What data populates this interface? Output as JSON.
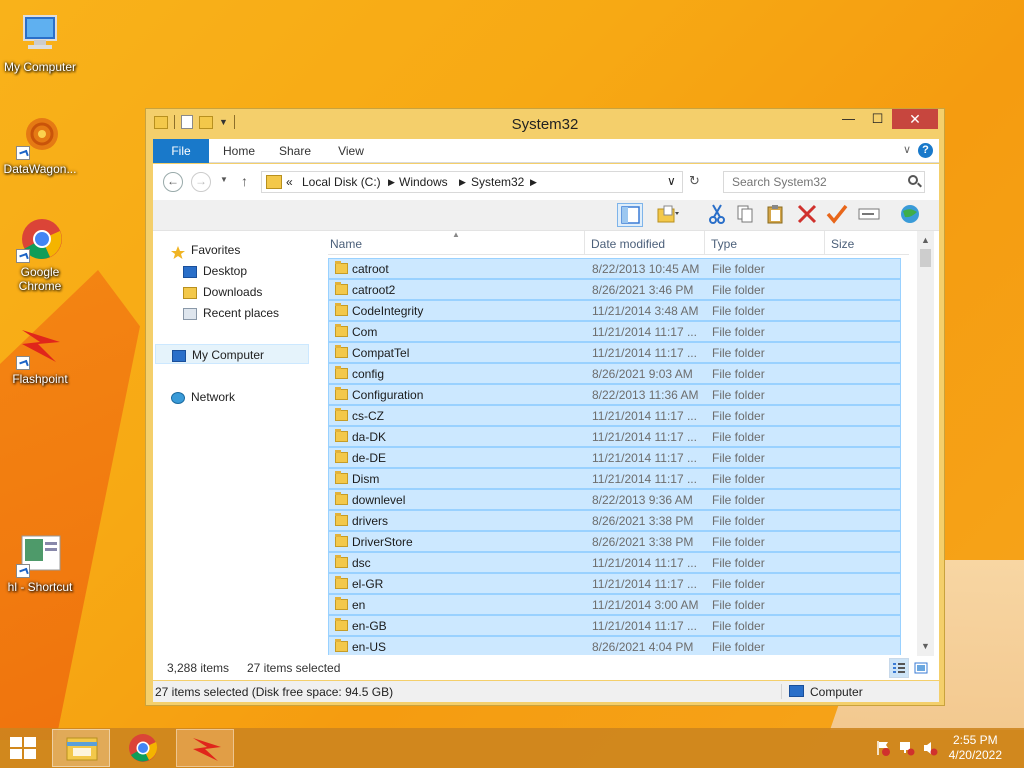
{
  "desktop": {
    "icons": [
      {
        "label": "My Computer"
      },
      {
        "label": "DataWagon..."
      },
      {
        "label": "Google Chrome"
      },
      {
        "label": "Flashpoint"
      },
      {
        "label": "hl - Shortcut"
      }
    ]
  },
  "window": {
    "title": "System32",
    "ribbon_tabs": {
      "file": "File",
      "home": "Home",
      "share": "Share",
      "view": "View"
    },
    "help_label": "?",
    "address": {
      "chevron": "«",
      "crumbs": [
        "Local Disk (C:)",
        "Windows",
        "System32"
      ]
    },
    "search": {
      "placeholder": "Search System32"
    },
    "nav_pane": {
      "favorites": "Favorites",
      "desktop": "Desktop",
      "downloads": "Downloads",
      "recent": "Recent places",
      "computer": "My Computer",
      "network": "Network"
    },
    "columns": {
      "name": "Name",
      "date": "Date modified",
      "type": "Type",
      "size": "Size"
    },
    "rows": [
      {
        "name": "catroot",
        "date": "8/22/2013 10:45 AM",
        "type": "File folder"
      },
      {
        "name": "catroot2",
        "date": "8/26/2021 3:46 PM",
        "type": "File folder"
      },
      {
        "name": "CodeIntegrity",
        "date": "11/21/2014 3:48 AM",
        "type": "File folder"
      },
      {
        "name": "Com",
        "date": "11/21/2014 11:17 ...",
        "type": "File folder"
      },
      {
        "name": "CompatTel",
        "date": "11/21/2014 11:17 ...",
        "type": "File folder"
      },
      {
        "name": "config",
        "date": "8/26/2021 9:03 AM",
        "type": "File folder"
      },
      {
        "name": "Configuration",
        "date": "8/22/2013 11:36 AM",
        "type": "File folder"
      },
      {
        "name": "cs-CZ",
        "date": "11/21/2014 11:17 ...",
        "type": "File folder"
      },
      {
        "name": "da-DK",
        "date": "11/21/2014 11:17 ...",
        "type": "File folder"
      },
      {
        "name": "de-DE",
        "date": "11/21/2014 11:17 ...",
        "type": "File folder"
      },
      {
        "name": "Dism",
        "date": "11/21/2014 11:17 ...",
        "type": "File folder"
      },
      {
        "name": "downlevel",
        "date": "8/22/2013 9:36 AM",
        "type": "File folder"
      },
      {
        "name": "drivers",
        "date": "8/26/2021 3:38 PM",
        "type": "File folder"
      },
      {
        "name": "DriverStore",
        "date": "8/26/2021 3:38 PM",
        "type": "File folder"
      },
      {
        "name": "dsc",
        "date": "11/21/2014 11:17 ...",
        "type": "File folder"
      },
      {
        "name": "el-GR",
        "date": "11/21/2014 11:17 ...",
        "type": "File folder"
      },
      {
        "name": "en",
        "date": "11/21/2014 3:00 AM",
        "type": "File folder"
      },
      {
        "name": "en-GB",
        "date": "11/21/2014 11:17 ...",
        "type": "File folder"
      },
      {
        "name": "en-US",
        "date": "8/26/2021 4:04 PM",
        "type": "File folder"
      }
    ],
    "status": {
      "item_count": "3,288 items",
      "selected_count": "27 items selected",
      "bar_text": "27 items selected (Disk free space: 94.5 GB)",
      "location": "Computer"
    }
  },
  "taskbar": {
    "time": "2:55 PM",
    "date": "4/20/2022"
  },
  "colors": {
    "selection": "#cce8ff",
    "file_tab": "#1979ca",
    "close_button": "#c7463e",
    "window_frame": "#f4cf6b"
  }
}
